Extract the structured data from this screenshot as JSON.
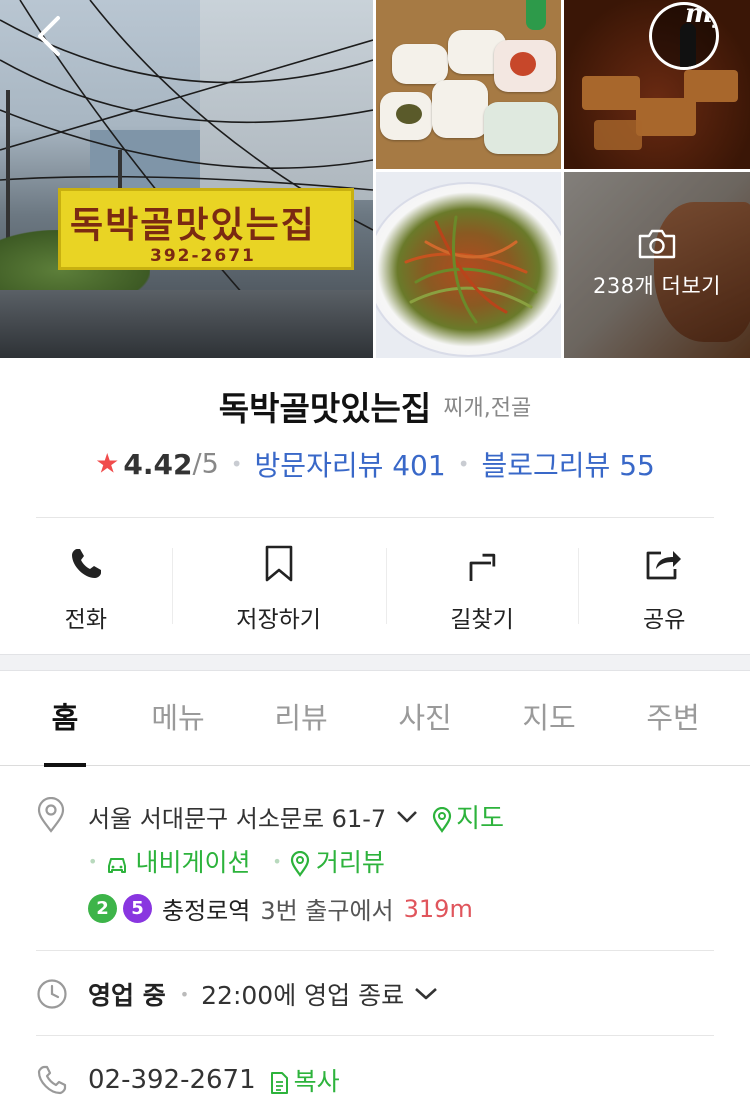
{
  "gallery": {
    "main_photo_sign": "독박골맛있는집",
    "main_photo_phone": "392-2671",
    "more_photos_label": "238개 더보기",
    "my_label": "my"
  },
  "place": {
    "name": "독박골맛있는집",
    "category": "찌개,전골",
    "rating": "4.42",
    "rating_max": "/5",
    "visitor_reviews": "방문자리뷰 401",
    "blog_reviews": "블로그리뷰 55"
  },
  "actions": [
    {
      "label": "전화",
      "icon": "phone-icon"
    },
    {
      "label": "저장하기",
      "icon": "bookmark-icon"
    },
    {
      "label": "길찾기",
      "icon": "directions-icon"
    },
    {
      "label": "공유",
      "icon": "share-icon"
    }
  ],
  "tabs": [
    {
      "label": "홈",
      "active": true
    },
    {
      "label": "메뉴"
    },
    {
      "label": "리뷰"
    },
    {
      "label": "사진"
    },
    {
      "label": "지도"
    },
    {
      "label": "주변"
    }
  ],
  "info": {
    "address": "서울 서대문구 서소문로 61-7",
    "map_link": "지도",
    "navigation": "내비게이션",
    "street_view": "거리뷰",
    "subway_lines": [
      {
        "number": "2",
        "color": "#3db449"
      },
      {
        "number": "5",
        "color": "#8936e0"
      }
    ],
    "station": "충정로역",
    "exit": "3번 출구에서",
    "distance": "319m",
    "open_status": "영업 중",
    "closing": "22:00에 영업 종료",
    "phone": "02-392-2671",
    "copy": "복사"
  },
  "colors": {
    "accent_green": "#2db33c",
    "link_blue": "#3968c8",
    "star_red": "#f04b4b",
    "distance_red": "#e0555c"
  }
}
